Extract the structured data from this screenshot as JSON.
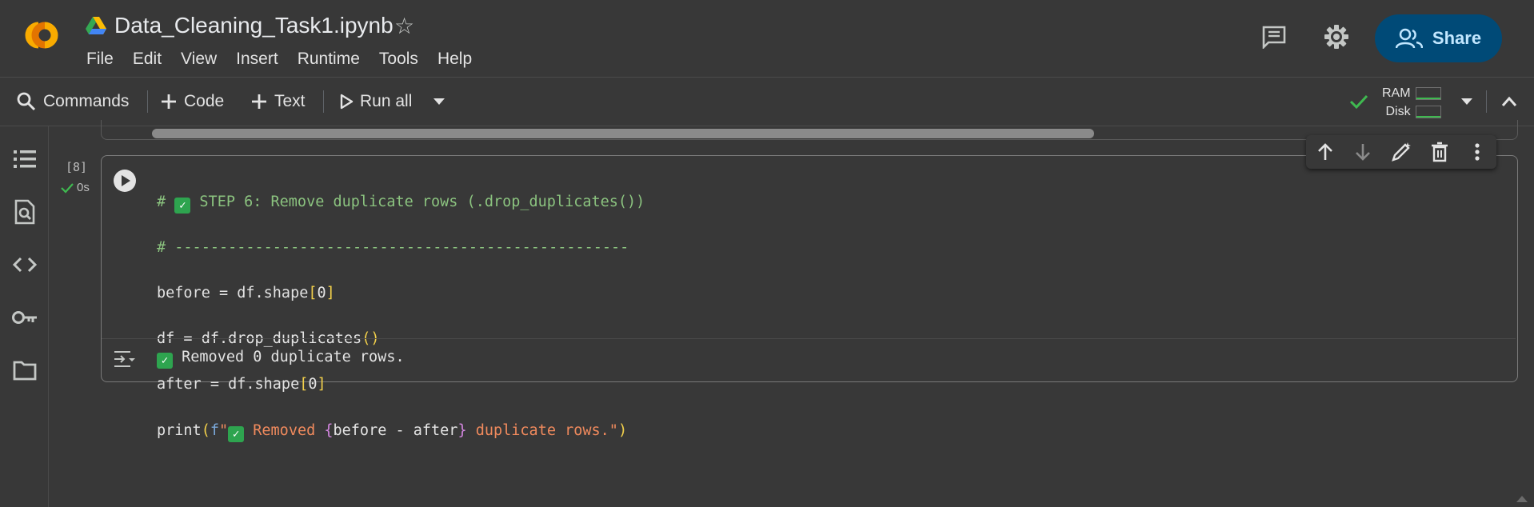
{
  "header": {
    "logo": "CO",
    "notebook_title": "Data_Cleaning_Task1.ipynb",
    "star_icon": "star-outline-icon",
    "menu": [
      "File",
      "Edit",
      "View",
      "Insert",
      "Runtime",
      "Tools",
      "Help"
    ],
    "share_label": "Share"
  },
  "toolbar": {
    "commands_label": "Commands",
    "code_label": "Code",
    "text_label": "Text",
    "run_all_label": "Run all",
    "ram_label": "RAM",
    "disk_label": "Disk"
  },
  "cell": {
    "exec_count": "[8]",
    "exec_time": "0s",
    "output": "Removed 0 duplicate rows."
  },
  "colors": {
    "background": "#383838",
    "share_bg": "#004a77",
    "comment": "#8bc37f",
    "string": "#f08a5d",
    "bracket": "#f2d04b",
    "keyword": "#7aa7d8",
    "success": "#3fb950"
  }
}
